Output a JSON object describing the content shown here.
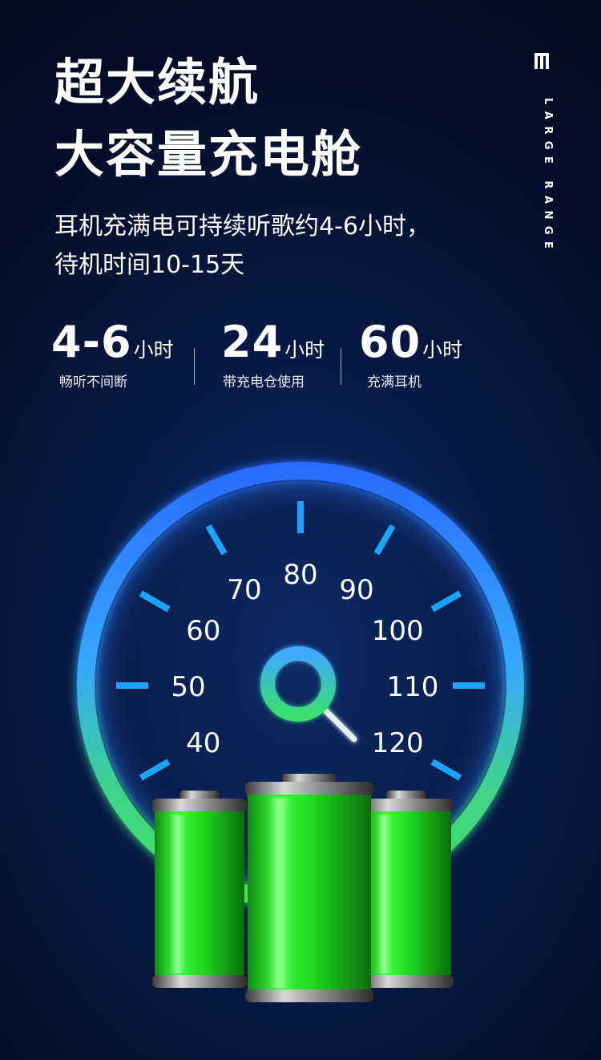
{
  "headline": {
    "line1": "超大续航",
    "line2": "大容量充电舱"
  },
  "subtitle": {
    "line1": "耳机充满电可持续听歌约4-6小时，",
    "line2": "待机时间10-15天"
  },
  "side_label": "LARGE RANGE",
  "stats": [
    {
      "value": "4-6",
      "unit": "小时",
      "desc": "畅听不间断"
    },
    {
      "value": "24",
      "unit": "小时",
      "desc": "带充电仓使用"
    },
    {
      "value": "60",
      "unit": "小时",
      "desc": "充满耳机"
    }
  ],
  "gauge": {
    "ticks": [
      "40",
      "50",
      "60",
      "70",
      "80",
      "90",
      "100",
      "110",
      "120"
    ],
    "ring_colors": [
      "#2a7fff",
      "#3fe05a"
    ],
    "tick_color": "#1aa4ff",
    "needle_value": 120
  },
  "batteries": {
    "count": 3,
    "fill_color": "#22dd22",
    "charge_level": 1.0
  }
}
